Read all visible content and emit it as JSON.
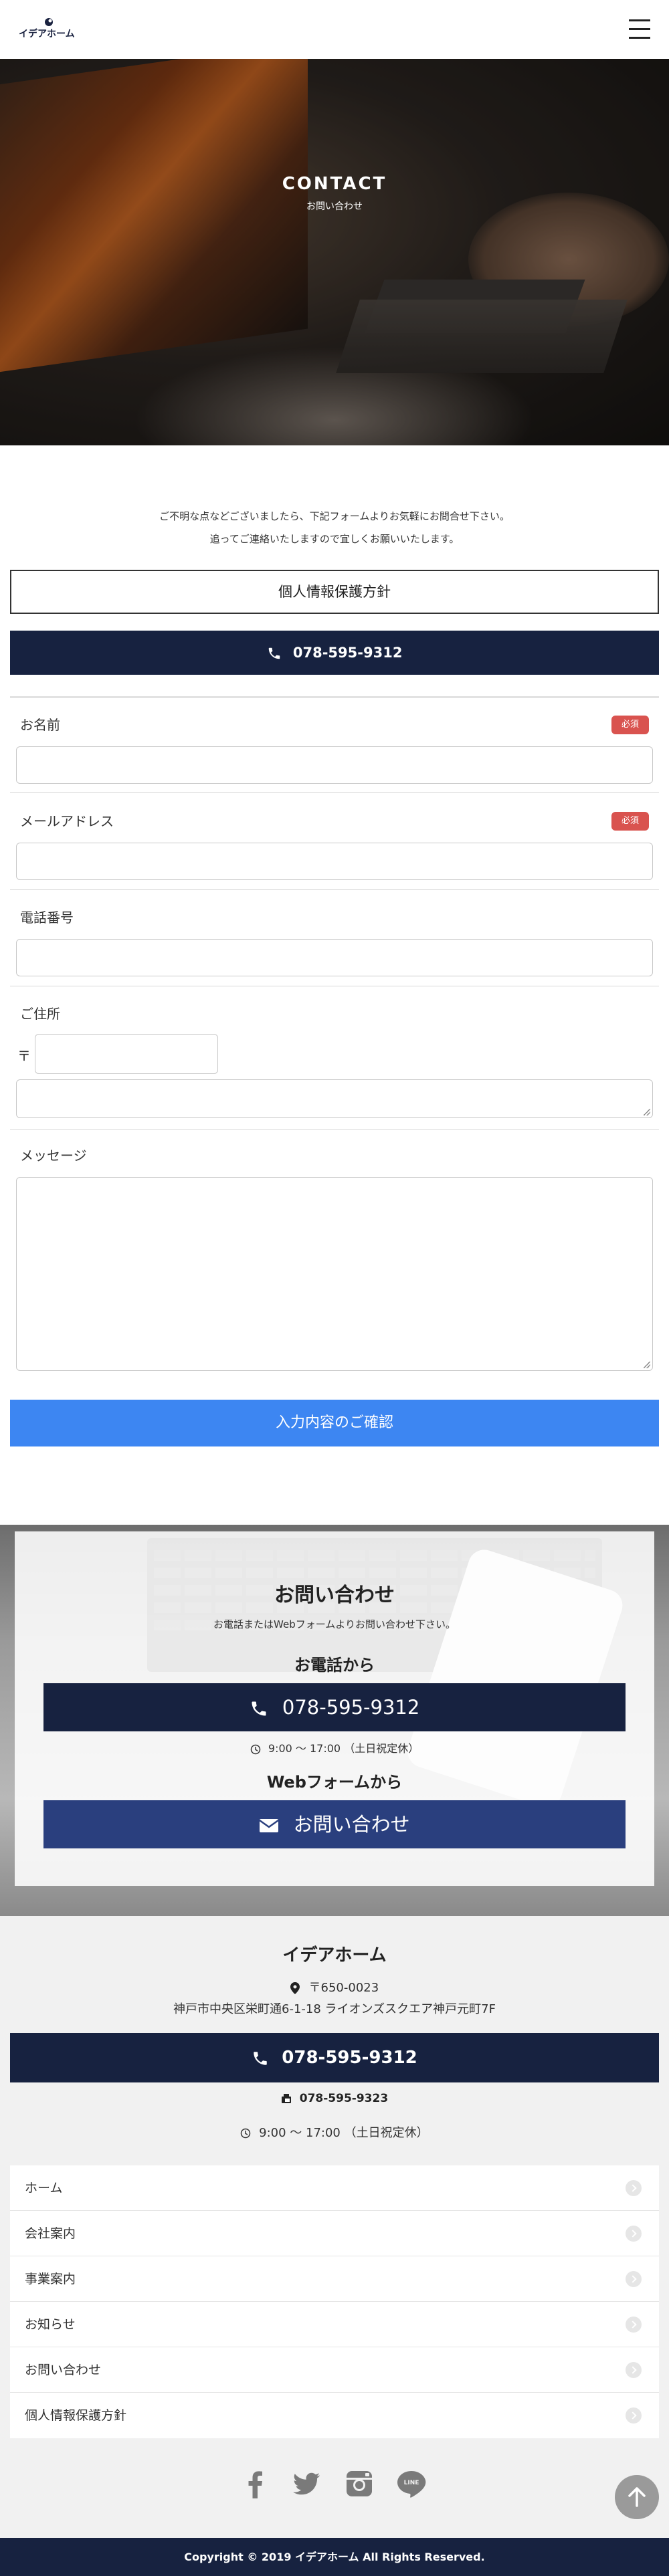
{
  "header": {
    "logo_text": "イデアホーム",
    "menu_icon": "hamburger-icon"
  },
  "hero": {
    "title": "CONTACT",
    "subtitle": "お問い合わせ"
  },
  "intro": {
    "line1": "ご不明な点などございましたら、下記フォームよりお気軽にお問合せ下さい。",
    "line2": "追ってご連絡いたしますので宜しくお願いいたします。"
  },
  "privacy_button": "個人情報保護方針",
  "phone_button": "078-595-9312",
  "form": {
    "name_label": "お名前",
    "email_label": "メールアドレス",
    "tel_label": "電話番号",
    "address_label": "ご住所",
    "zip_mark": "〒",
    "message_label": "メッセージ",
    "required_badge": "必須",
    "submit_label": "入力内容のご確認"
  },
  "contact": {
    "title": "お問い合わせ",
    "lead": "お電話またはWebフォームよりお問い合わせ下さい。",
    "phone_heading": "お電話から",
    "phone": "078-595-9312",
    "hours": "9:00 ～ 17:00 （土日祝定休）",
    "web_heading": "Webフォームから",
    "web_button": "お問い合わせ"
  },
  "footer": {
    "company": "イデアホーム",
    "zip": "〒650-0023",
    "address": "神戸市中央区栄町通6-1-18 ライオンズスクエア神戸元町7F",
    "phone": "078-595-9312",
    "fax": "078-595-9323",
    "hours": "9:00 ～ 17:00 （土日祝定休）",
    "nav": [
      "ホーム",
      "会社案内",
      "事業案内",
      "お知らせ",
      "お問い合わせ",
      "個人情報保護方針"
    ],
    "social_icons": [
      "facebook-icon",
      "twitter-icon",
      "instagram-icon",
      "line-icon"
    ],
    "line_text": "LINE",
    "copyright": "Copyright © 2019 イデアホーム All Rights Reserved."
  },
  "colors": {
    "navy": "#172240",
    "blue": "#3d86f2",
    "web_blue": "#2a3f7e",
    "required": "#d9534f"
  }
}
